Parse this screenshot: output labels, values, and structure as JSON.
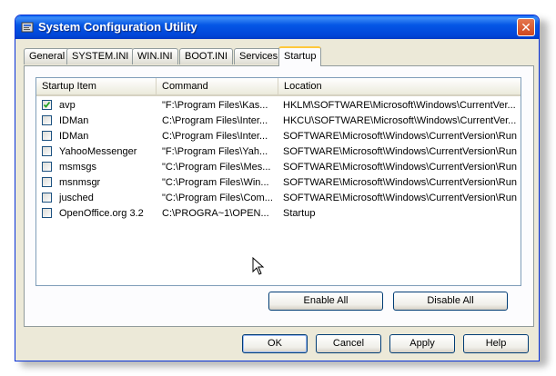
{
  "window": {
    "title": "System Configuration Utility",
    "close_symbol": "✕"
  },
  "tabs": [
    {
      "label": "General"
    },
    {
      "label": "SYSTEM.INI"
    },
    {
      "label": "WIN.INI"
    },
    {
      "label": "BOOT.INI"
    },
    {
      "label": "Services"
    },
    {
      "label": "Startup",
      "active": true
    }
  ],
  "listview": {
    "columns": [
      "Startup Item",
      "Command",
      "Location"
    ],
    "rows": [
      {
        "checked": true,
        "item": "avp",
        "command": "\"F:\\Program Files\\Kas...",
        "location": "HKLM\\SOFTWARE\\Microsoft\\Windows\\CurrentVer..."
      },
      {
        "checked": false,
        "item": "IDMan",
        "command": "C:\\Program Files\\Inter...",
        "location": "HKCU\\SOFTWARE\\Microsoft\\Windows\\CurrentVer..."
      },
      {
        "checked": false,
        "item": "IDMan",
        "command": "C:\\Program Files\\Inter...",
        "location": "SOFTWARE\\Microsoft\\Windows\\CurrentVersion\\Run"
      },
      {
        "checked": false,
        "item": "YahooMessenger",
        "command": "\"F:\\Program Files\\Yah...",
        "location": "SOFTWARE\\Microsoft\\Windows\\CurrentVersion\\Run"
      },
      {
        "checked": false,
        "item": "msmsgs",
        "command": "\"C:\\Program Files\\Mes...",
        "location": "SOFTWARE\\Microsoft\\Windows\\CurrentVersion\\Run"
      },
      {
        "checked": false,
        "item": "msnmsgr",
        "command": "\"C:\\Program Files\\Win...",
        "location": "SOFTWARE\\Microsoft\\Windows\\CurrentVersion\\Run"
      },
      {
        "checked": false,
        "item": "jusched",
        "command": "\"C:\\Program Files\\Com...",
        "location": "SOFTWARE\\Microsoft\\Windows\\CurrentVersion\\Run"
      },
      {
        "checked": false,
        "item": "OpenOffice.org 3.2",
        "command": "C:\\PROGRA~1\\OPEN...",
        "location": "Startup"
      }
    ]
  },
  "panel_buttons": {
    "enable_all": "Enable All",
    "disable_all": "Disable All"
  },
  "dialog_buttons": {
    "ok": "OK",
    "cancel": "Cancel",
    "apply": "Apply",
    "help": "Help"
  }
}
